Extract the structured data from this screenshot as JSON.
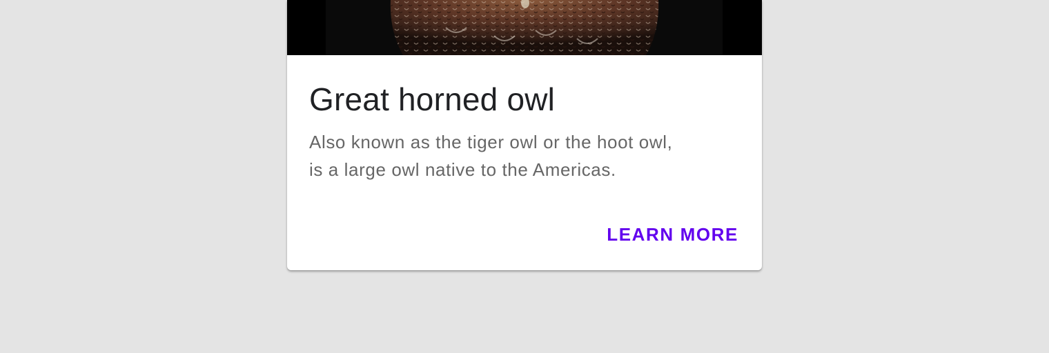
{
  "card": {
    "image": {
      "subject": "owl-photo"
    },
    "title": "Great horned owl",
    "description_lines": [
      "Also known as the tiger owl or the hoot owl,",
      "is a large owl native to the Americas."
    ],
    "action_label": "LEARN MORE"
  },
  "colors": {
    "page_background": "#e4e4e4",
    "card_background": "#ffffff",
    "title": "#202124",
    "description": "#666666",
    "accent": "#6200ee"
  }
}
